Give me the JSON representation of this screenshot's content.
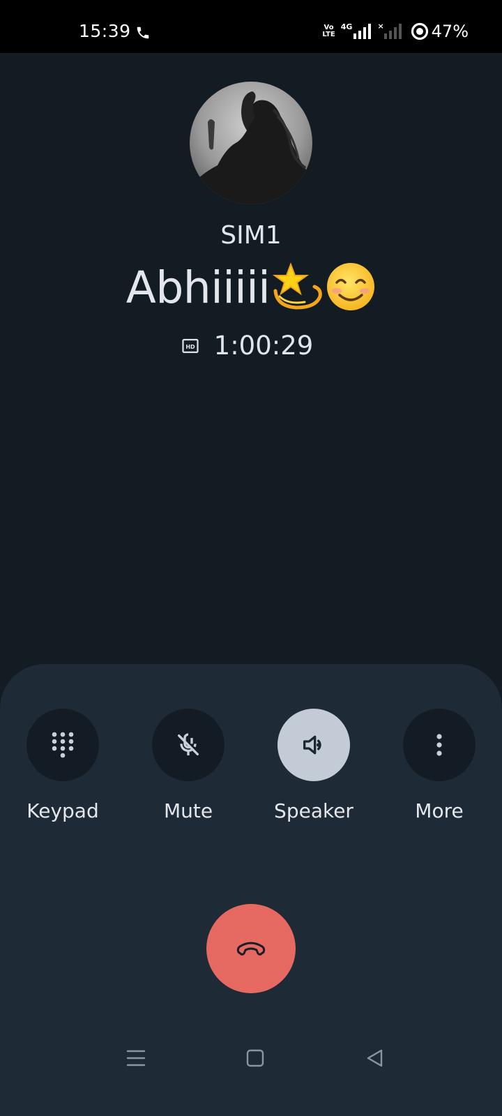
{
  "status_bar": {
    "time": "15:39",
    "volte_line1": "Vo",
    "volte_line2": "LTE",
    "network_type": "4G",
    "sim2_status": "×",
    "battery": "47%",
    "icons": [
      "phone-call-icon",
      "volte-icon",
      "signal-icon",
      "no-signal-icon",
      "ring-icon"
    ]
  },
  "caller": {
    "sim": "SIM1",
    "name": "Abhiiiii",
    "name_emojis": [
      "dizzy-star-emoji",
      "smiling-face-emoji"
    ],
    "duration": "1:00:29",
    "hd_icon": "hd-voice-icon"
  },
  "controls": [
    {
      "label": "Keypad",
      "icon": "dialpad-icon",
      "active": false
    },
    {
      "label": "Mute",
      "icon": "mic-off-icon",
      "active": false
    },
    {
      "label": "Speaker",
      "icon": "speaker-icon",
      "active": true
    },
    {
      "label": "More",
      "icon": "more-vert-icon",
      "active": false
    }
  ],
  "end_call": {
    "icon": "end-call-icon",
    "color": "#e66a62"
  },
  "nav": {
    "icons": [
      "menu-icon",
      "home-icon",
      "back-icon"
    ]
  },
  "colors": {
    "background": "#141c23",
    "panel": "#1e2a36",
    "button": "#131c24",
    "button_active": "#c3ccd6"
  }
}
